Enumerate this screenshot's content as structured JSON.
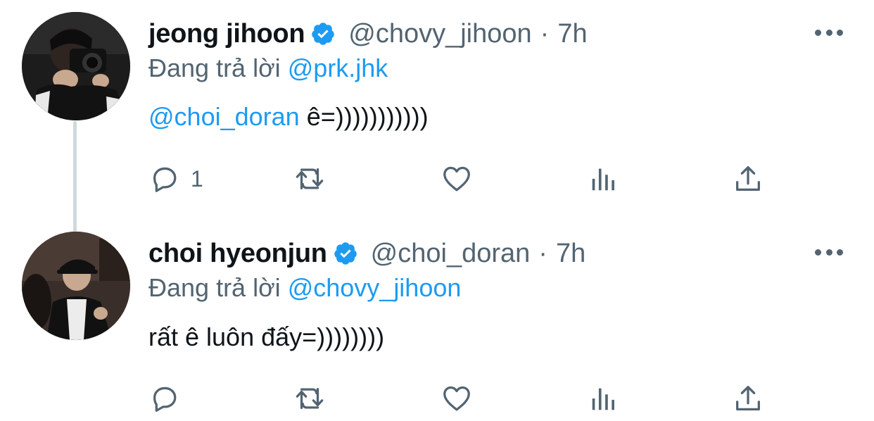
{
  "tweets": [
    {
      "name": "jeong jihoon",
      "handle": "@chovy_jihoon",
      "separator": "·",
      "time": "7h",
      "reply_prefix": "Đang trả lời",
      "reply_mention": "@prk.jhk",
      "body_mention": "@choi_doran",
      "body_text": " ê=)))))))))))",
      "reply_count": "1",
      "verified": true
    },
    {
      "name": "choi hyeonjun",
      "handle": "@choi_doran",
      "separator": "·",
      "time": "7h",
      "reply_prefix": "Đang trả lời",
      "reply_mention": "@chovy_jihoon",
      "body_mention": "",
      "body_text": "rất ê luôn đấy=))))))))",
      "reply_count": "",
      "verified": true
    }
  ],
  "icons": {
    "reply": "reply-icon",
    "retweet": "retweet-icon",
    "like": "heart-icon",
    "views": "analytics-icon",
    "share": "share-icon",
    "more": "more-icon",
    "verified": "verified-badge-icon"
  },
  "colors": {
    "link": "#1d9bf0",
    "secondary_text": "#536471",
    "primary_text": "#0f1419",
    "thread_line": "#cfd9de"
  }
}
